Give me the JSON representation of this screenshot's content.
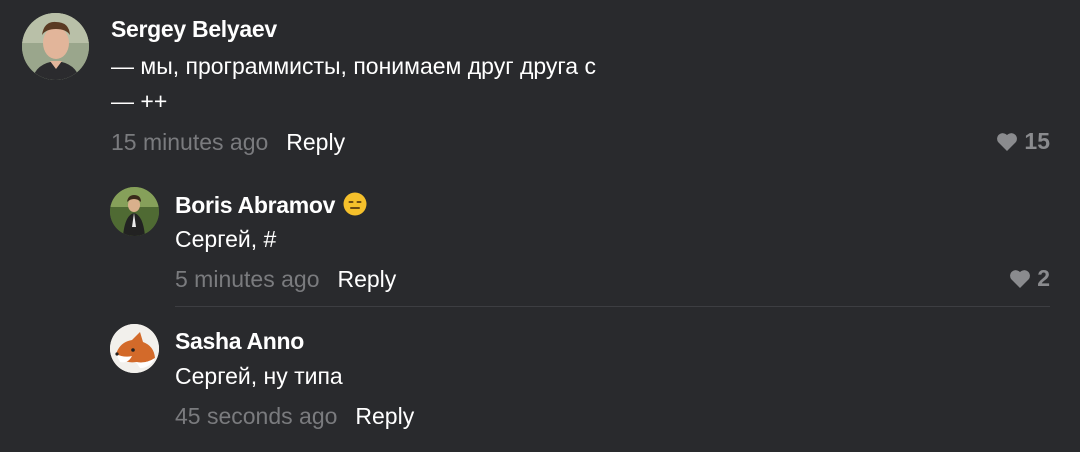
{
  "comments": [
    {
      "author": "Sergey Belyaev",
      "text": "— мы, программисты, понимаем друг друга с\n— ++",
      "time": "15 minutes ago",
      "reply_label": "Reply",
      "likes": "15",
      "avatar_icon": "person-photo"
    },
    {
      "author": "Boris Abramov",
      "badge_icon": "expressionless-face-emoji",
      "text": "Сергей, #",
      "time": "5 minutes ago",
      "reply_label": "Reply",
      "likes": "2",
      "avatar_icon": "person-photo"
    },
    {
      "author": "Sasha Anno",
      "text": "Сергей, ну типа",
      "time": "45 seconds ago",
      "reply_label": "Reply",
      "avatar_icon": "fox-photo"
    }
  ],
  "colors": {
    "background": "#292a2d",
    "text": "#ffffff",
    "muted": "#7a7b7e",
    "divider": "#3d3e42"
  }
}
